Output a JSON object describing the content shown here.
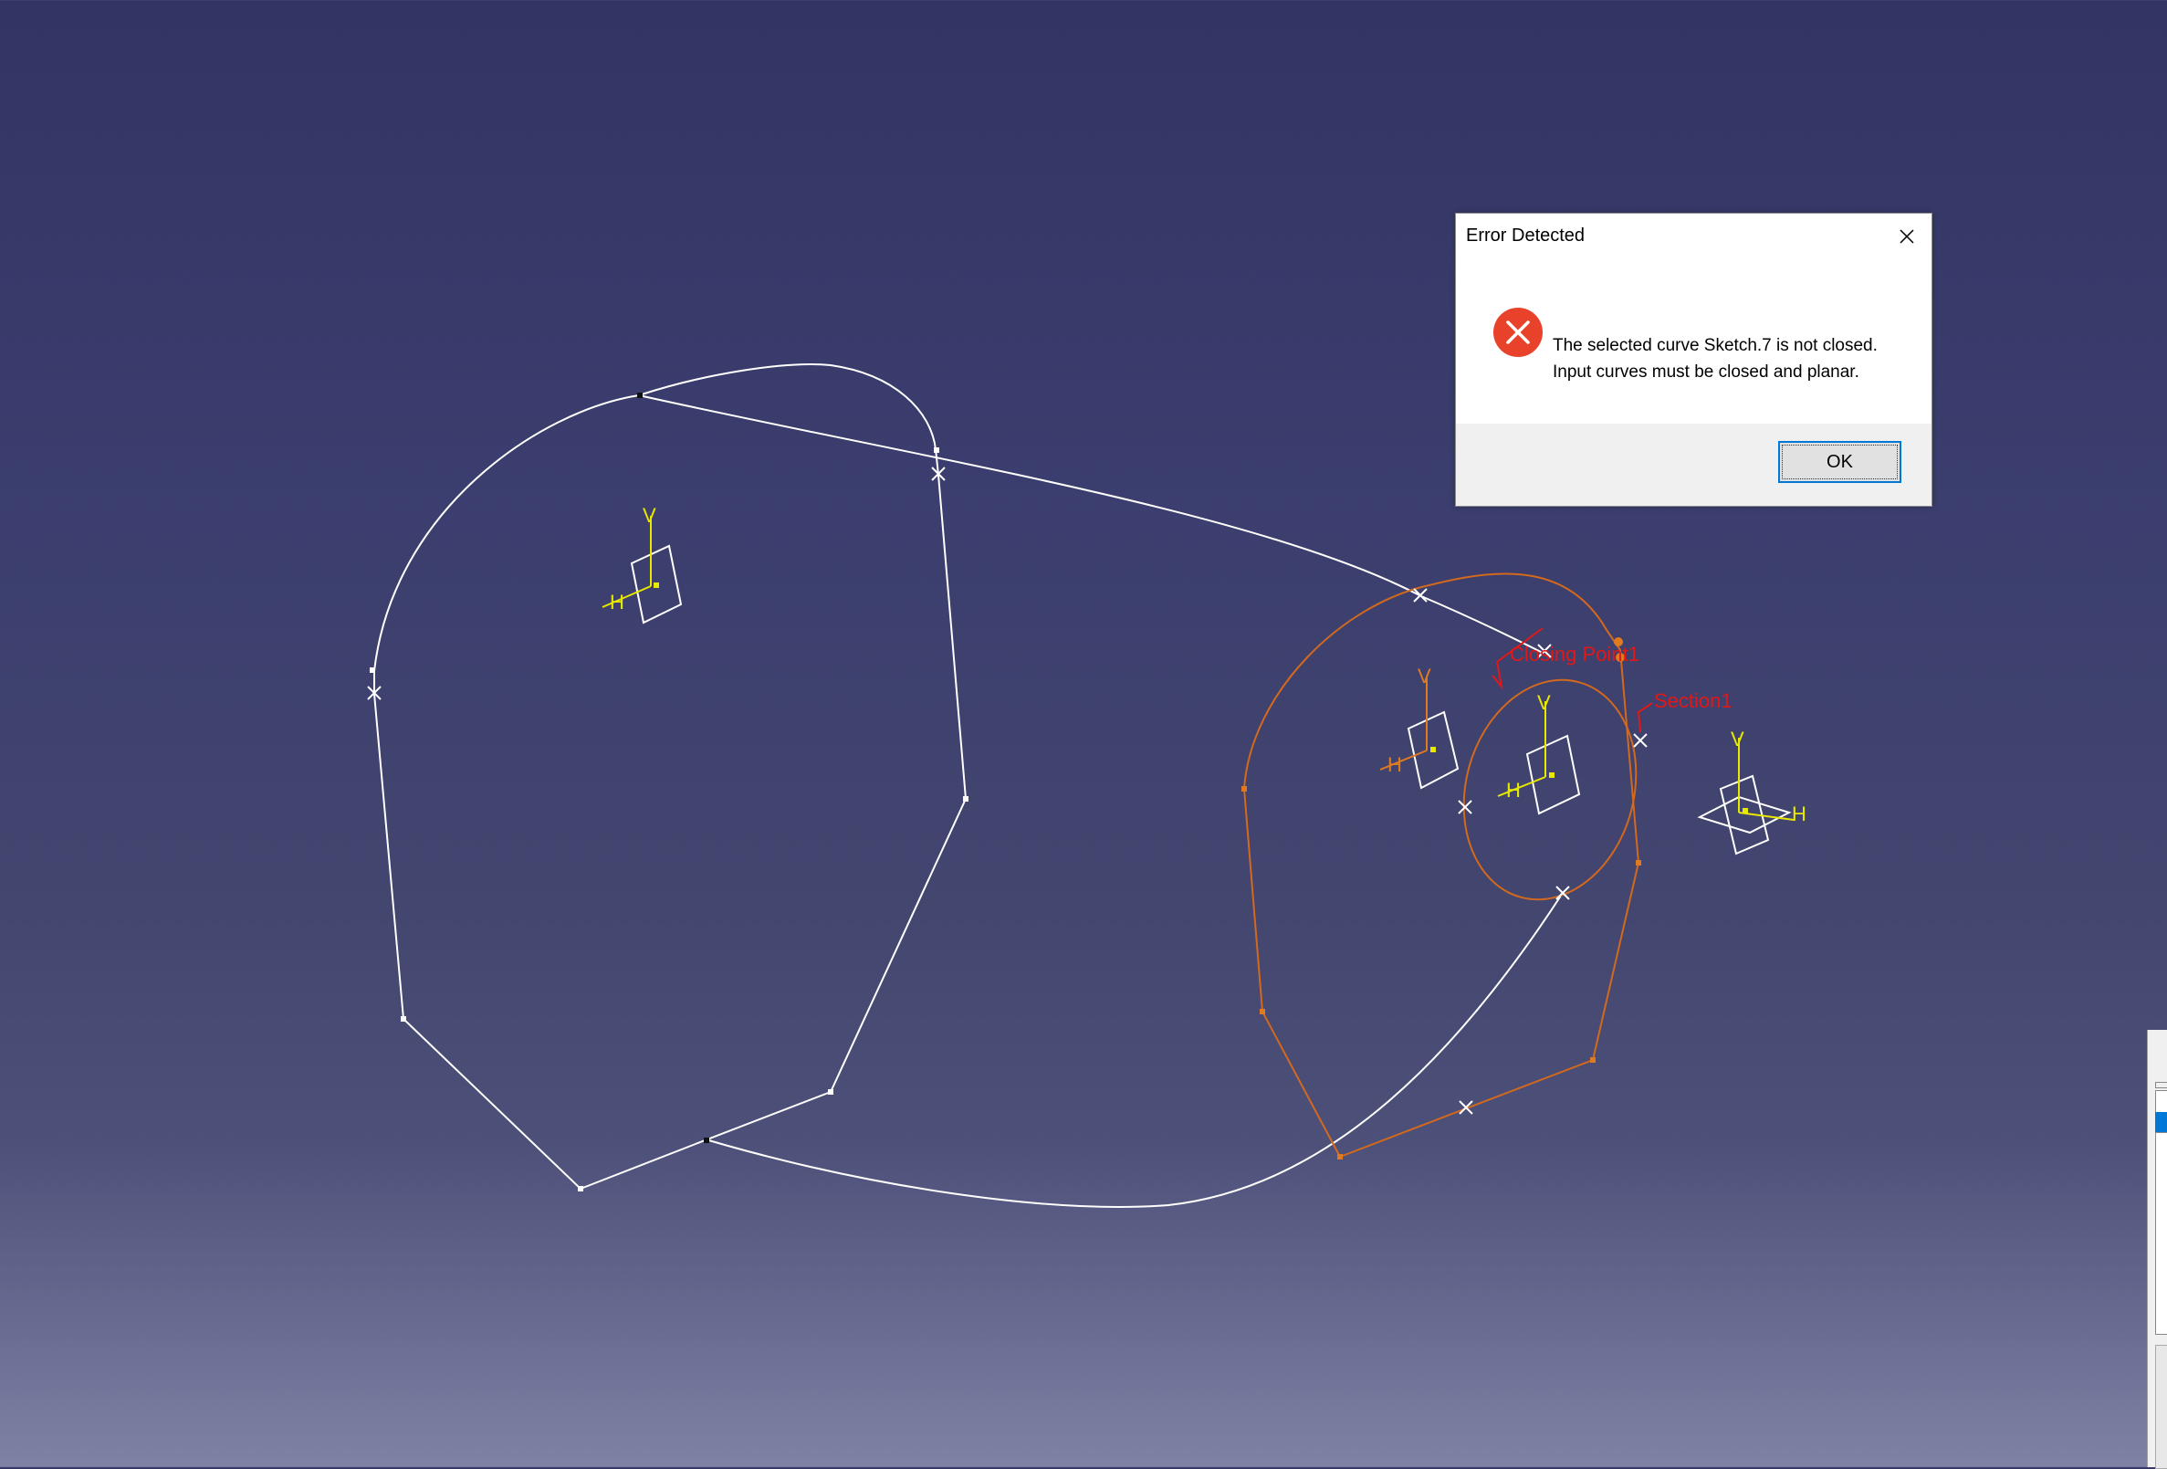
{
  "canvas": {
    "labels": {
      "closing_point": "Closing Point1",
      "section": "Section1"
    },
    "axis": {
      "vertical": "V",
      "horizontal": "H"
    },
    "colors": {
      "curve_white": "#ffffff",
      "curve_orange": "#d2691e",
      "axis_yellow": "#e8e800",
      "label_red": "#e01818"
    }
  },
  "dialog": {
    "title": "Error Detected",
    "message_line1": "The selected curve Sketch.7 is not closed.",
    "message_line2": "Input curves must be closed and planar.",
    "ok_label": "OK",
    "icon": "error-icon",
    "close_icon": "close-icon"
  }
}
